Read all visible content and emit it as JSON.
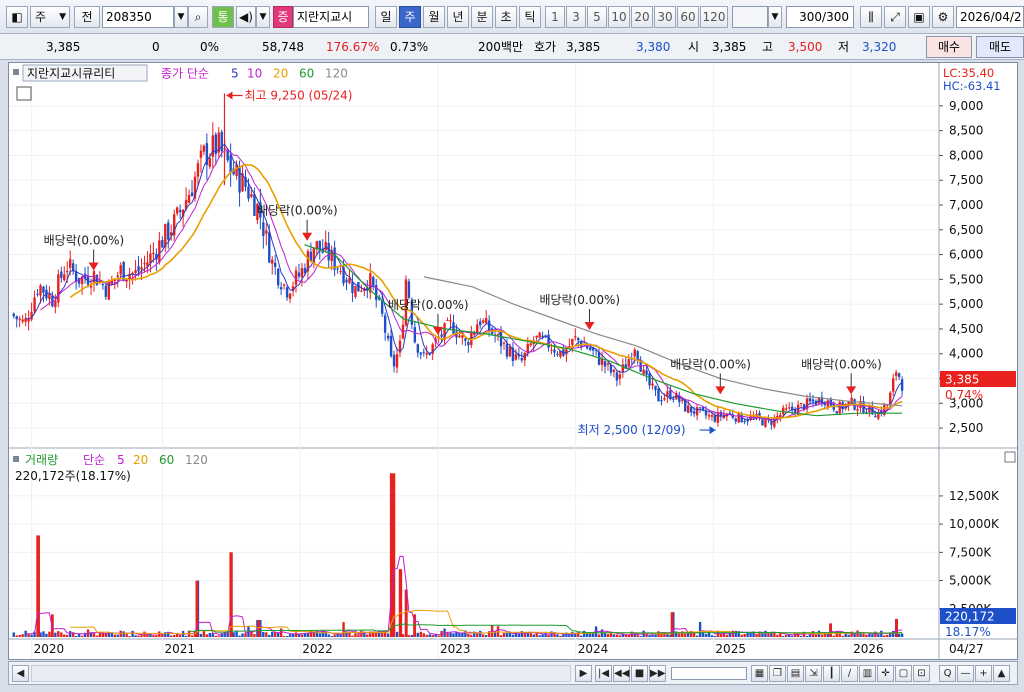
{
  "toolbar": {
    "market": "주",
    "mode": "전",
    "code": "208350",
    "trade_badge": "통",
    "stock_badge": "증",
    "stock_name": "지란지교시",
    "periods": [
      "일",
      "주",
      "월",
      "년",
      "분",
      "초",
      "틱"
    ],
    "active_period": "주",
    "minutes": [
      "1",
      "3",
      "5",
      "10",
      "20",
      "30",
      "60",
      "120"
    ],
    "count": "300",
    "count_total": "/300",
    "date": "2026/04/2"
  },
  "quote": {
    "price": "3,385",
    "change": "0",
    "change_pct": "0%",
    "volume": "58,748",
    "volume_ratio": "176.67%",
    "turnover_pct": "0.73%",
    "amount": "200백만",
    "bid_label": "호가",
    "ask": "3,385",
    "bid": "3,380",
    "open_label": "시",
    "open": "3,385",
    "high_label": "고",
    "high": "3,500",
    "low_label": "저",
    "low": "3,320",
    "buy_label": "매수",
    "sell_label": "매도"
  },
  "colors": {
    "up": "#e8201e",
    "down": "#1d4fc8",
    "ma5": "#2f38c2",
    "ma10": "#c21fcf",
    "ma20": "#e8a000",
    "ma60": "#1e9a2e",
    "ma120": "#8a8a8a"
  },
  "chart_data": [
    {
      "type": "candlestick",
      "title": "지란지교시큐리티",
      "legend": [
        "종가 단순",
        "5",
        "10",
        "20",
        "60",
        "120"
      ],
      "y_ticks": [
        "9,000",
        "8,500",
        "8,000",
        "7,500",
        "7,000",
        "6,500",
        "6,000",
        "5,500",
        "5,000",
        "4,500",
        "4,000",
        "3,500",
        "3,000",
        "2,500"
      ],
      "ylim": [
        2300,
        9300
      ],
      "x_labels": [
        "2020",
        "2021",
        "2022",
        "2023",
        "2024",
        "2025",
        "2026"
      ],
      "x_end_label": "04/27",
      "lc_label": "LC:35.40",
      "hc_label": "HC:-63.41",
      "current_price_label": "3,385",
      "current_pct_label": "0.74%",
      "annotations": [
        {
          "text": "최고 9,250 (05/24)",
          "x": "2021-05",
          "value": 9250
        },
        {
          "text": "최저 2,500 (12/09)",
          "x": "2024-12",
          "value": 2500
        },
        {
          "text": "배당락(0.00%)",
          "x": "2020-12",
          "value": 5700
        },
        {
          "text": "배당락(0.00%)",
          "x": "2021-12",
          "value": 6300
        },
        {
          "text": "배당락(0.00%)",
          "x": "2022-12",
          "value": 4400
        },
        {
          "text": "배당락(0.00%)",
          "x": "2023-12",
          "value": 4500
        },
        {
          "text": "배당락(0.00%)",
          "x": "2024-12",
          "value": 3200
        },
        {
          "text": "배당락(0.00%)",
          "x": "2025-12",
          "value": 3200
        }
      ],
      "close_path": [
        [
          2019.85,
          4800
        ],
        [
          2019.95,
          4600
        ],
        [
          2020.05,
          5400
        ],
        [
          2020.15,
          5100
        ],
        [
          2020.25,
          5800
        ],
        [
          2020.35,
          5500
        ],
        [
          2020.45,
          5600
        ],
        [
          2020.55,
          5300
        ],
        [
          2020.65,
          5700
        ],
        [
          2020.75,
          5600
        ],
        [
          2020.85,
          5900
        ],
        [
          2020.95,
          6300
        ],
        [
          2021.05,
          6700
        ],
        [
          2021.15,
          7300
        ],
        [
          2021.25,
          8000
        ],
        [
          2021.35,
          8200
        ],
        [
          2021.45,
          7700
        ],
        [
          2021.55,
          7400
        ],
        [
          2021.65,
          6900
        ],
        [
          2021.75,
          5800
        ],
        [
          2021.85,
          5300
        ],
        [
          2021.95,
          5600
        ],
        [
          2022.05,
          6200
        ],
        [
          2022.15,
          6000
        ],
        [
          2022.25,
          5700
        ],
        [
          2022.35,
          5300
        ],
        [
          2022.45,
          5500
        ],
        [
          2022.55,
          4700
        ],
        [
          2022.62,
          3700
        ],
        [
          2022.68,
          4200
        ],
        [
          2022.72,
          5600
        ],
        [
          2022.78,
          4300
        ],
        [
          2022.85,
          3900
        ],
        [
          2022.95,
          4300
        ],
        [
          2023.05,
          4600
        ],
        [
          2023.15,
          4200
        ],
        [
          2023.25,
          4700
        ],
        [
          2023.35,
          4400
        ],
        [
          2023.45,
          4100
        ],
        [
          2023.55,
          3800
        ],
        [
          2023.65,
          4300
        ],
        [
          2023.75,
          4200
        ],
        [
          2023.85,
          4000
        ],
        [
          2023.95,
          4300
        ],
        [
          2024.05,
          4100
        ],
        [
          2024.15,
          3800
        ],
        [
          2024.25,
          3500
        ],
        [
          2024.32,
          3800
        ],
        [
          2024.38,
          4200
        ],
        [
          2024.45,
          3500
        ],
        [
          2024.55,
          3100
        ],
        [
          2024.65,
          3200
        ],
        [
          2024.75,
          2900
        ],
        [
          2024.85,
          2800
        ],
        [
          2024.95,
          2700
        ],
        [
          2025.05,
          2800
        ],
        [
          2025.15,
          2700
        ],
        [
          2025.25,
          2700
        ],
        [
          2025.35,
          2600
        ],
        [
          2025.45,
          2800
        ],
        [
          2025.55,
          2900
        ],
        [
          2025.65,
          3000
        ],
        [
          2025.75,
          3100
        ],
        [
          2025.85,
          2900
        ],
        [
          2025.95,
          3000
        ],
        [
          2026.05,
          2900
        ],
        [
          2026.15,
          2800
        ],
        [
          2026.22,
          3000
        ],
        [
          2026.28,
          3700
        ],
        [
          2026.32,
          3385
        ]
      ],
      "ma60_path": [
        [
          2021.98,
          6200
        ],
        [
          2022.2,
          6000
        ],
        [
          2022.45,
          5300
        ],
        [
          2022.7,
          4700
        ],
        [
          2023.0,
          4500
        ],
        [
          2023.3,
          4400
        ],
        [
          2023.6,
          4250
        ],
        [
          2023.9,
          4100
        ],
        [
          2024.2,
          3850
        ],
        [
          2024.5,
          3500
        ],
        [
          2024.8,
          3200
        ],
        [
          2025.1,
          3000
        ],
        [
          2025.4,
          2850
        ],
        [
          2025.7,
          2750
        ],
        [
          2026.0,
          2800
        ],
        [
          2026.32,
          2800
        ]
      ],
      "ma120_path": [
        [
          2022.85,
          5550
        ],
        [
          2023.2,
          5350
        ],
        [
          2023.5,
          5000
        ],
        [
          2023.8,
          4700
        ],
        [
          2024.1,
          4400
        ],
        [
          2024.4,
          4150
        ],
        [
          2024.7,
          3800
        ],
        [
          2025.0,
          3500
        ],
        [
          2025.3,
          3300
        ],
        [
          2025.6,
          3150
        ],
        [
          2025.9,
          3050
        ],
        [
          2026.32,
          2950
        ]
      ]
    },
    {
      "type": "bar",
      "title": "거래량",
      "legend": [
        "단순",
        "5",
        "20",
        "60",
        "120"
      ],
      "info": "220,172주(18.17%)",
      "y_ticks": [
        "12,500K",
        "10,000K",
        "7,500K",
        "5,000K",
        "2,500K"
      ],
      "ylim": [
        0,
        14000000
      ],
      "current_value_label": "220,172",
      "current_pct_label": "18.17%",
      "spikes": [
        {
          "x": 2020.05,
          "value": 9000000
        },
        {
          "x": 2020.15,
          "value": 2000000
        },
        {
          "x": 2021.2,
          "value": 5000000
        },
        {
          "x": 2021.45,
          "value": 7500000
        },
        {
          "x": 2021.65,
          "value": 1500000
        },
        {
          "x": 2022.62,
          "value": 14500000
        },
        {
          "x": 2022.68,
          "value": 6000000
        },
        {
          "x": 2022.72,
          "value": 4200000
        },
        {
          "x": 2022.78,
          "value": 2000000
        },
        {
          "x": 2024.65,
          "value": 2200000
        },
        {
          "x": 2025.8,
          "value": 1200000
        },
        {
          "x": 2026.28,
          "value": 1600000
        }
      ]
    }
  ],
  "scrollbar": {
    "buttons": [
      "◀",
      "▶",
      "|◀",
      "◀◀",
      "■",
      "▶▶",
      "Q",
      "—",
      "+",
      "▲"
    ]
  }
}
